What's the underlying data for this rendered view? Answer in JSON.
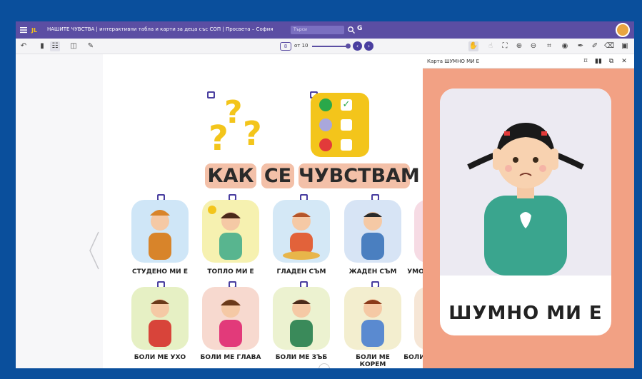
{
  "titlebar": {
    "logo_text": "JL",
    "title": "НАШИТЕ ЧУВСТВА | интерактивни табла и карти за деца със СОП | Просвета – София",
    "search_placeholder": "Търси",
    "g_label": "G"
  },
  "toolbar": {
    "page_current": "8",
    "page_of": "от 10"
  },
  "page": {
    "title_words": [
      "КАК",
      "СЕ",
      "ЧУВСТВАМ"
    ],
    "row1_labels": [
      "СТУДЕНО МИ Е",
      "ТОПЛО МИ Е",
      "ГЛАДЕН СЪМ",
      "ЖАДЕН СЪМ",
      "УМО"
    ],
    "row2_labels": [
      "БОЛИ МЕ УХО",
      "БОЛИ МЕ ГЛАВА",
      "БОЛИ МЕ ЗЪБ",
      "БОЛИ МЕ КОРЕМ",
      "БОЛИ"
    ],
    "check_mark": "✓"
  },
  "card_panel": {
    "header_title": "Карта ШУМНО МИ Е",
    "card_label": "ШУМНО МИ Е"
  },
  "colors": {
    "header": "#5b4ea3",
    "accent_yellow": "#f3c51b",
    "card_bg": "#f2a184",
    "frame_border": "#0a4f9c"
  },
  "icons": [
    "menu-icon",
    "search-icon",
    "undo-icon",
    "hand-icon",
    "zoom-in-icon",
    "zoom-out-icon",
    "crop-icon",
    "eye-icon",
    "pen-icon",
    "eraser-icon",
    "save-icon",
    "bookmark-icon",
    "columns-icon",
    "external-icon",
    "close-icon"
  ]
}
